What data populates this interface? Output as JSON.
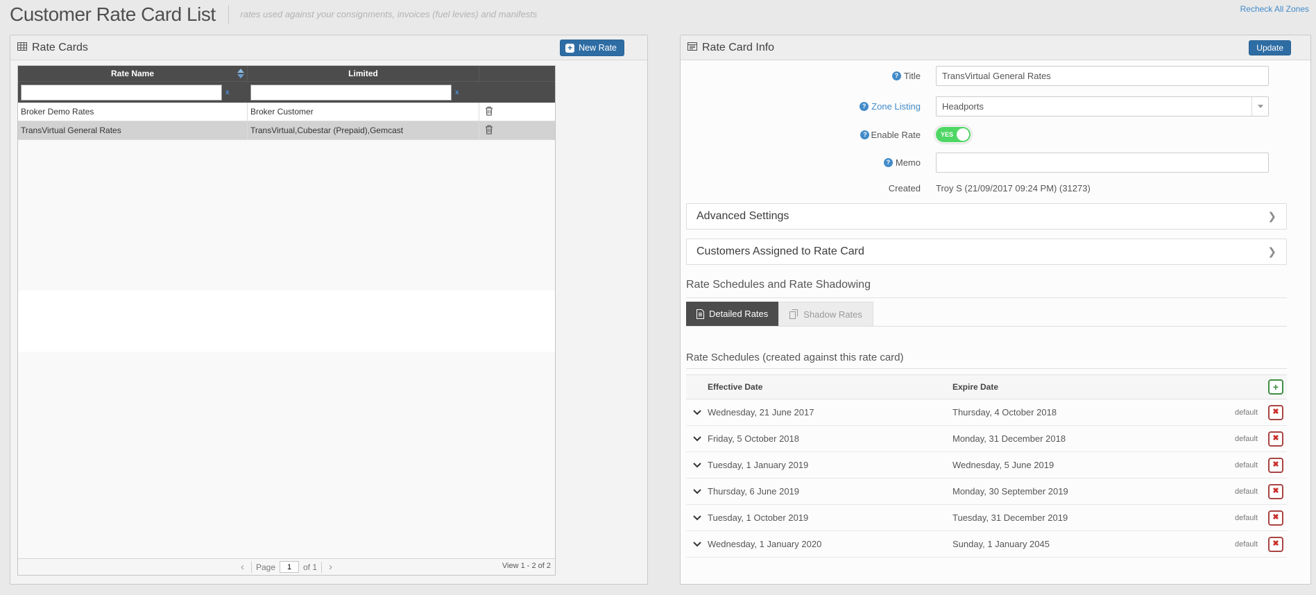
{
  "page": {
    "title": "Customer Rate Card List",
    "subtitle": "rates used against your consignments, invoices (fuel levies) and manifests",
    "recheck_link": "Recheck All Zones"
  },
  "icons": {
    "plus": "+",
    "x_mark": "✖",
    "clear_x": "x",
    "prev_arrow": "‹",
    "next_arrow": "›",
    "accordion_chevron": "❯",
    "question_mark": "?"
  },
  "rate_cards_panel": {
    "title": "Rate Cards",
    "new_rate_button": "New Rate",
    "grid": {
      "columns": [
        "Rate Name",
        "Limited"
      ],
      "rows": [
        {
          "rate_name": "Broker Demo Rates",
          "limited": "Broker Customer"
        },
        {
          "rate_name": "TransVirtual General Rates",
          "limited": "TransVirtual,Cubestar (Prepaid),Gemcast"
        }
      ],
      "pager": {
        "page_label": "Page",
        "page_value": "1",
        "of_label": "of 1",
        "view_label": "View 1 - 2 of 2"
      }
    }
  },
  "rate_card_info_panel": {
    "title": "Rate Card Info",
    "update_button": "Update",
    "fields": {
      "title_label": "Title",
      "title_value": "TransVirtual General Rates",
      "zone_listing_label": "Zone Listing",
      "zone_listing_value": "Headports",
      "enable_rate_label": "Enable Rate",
      "enable_rate_value": "YES",
      "memo_label": "Memo",
      "memo_value": "",
      "created_label": "Created",
      "created_value": "Troy S (21/09/2017 09:24 PM) (31273)"
    },
    "accordions": [
      {
        "label": "Advanced Settings"
      },
      {
        "label": "Customers Assigned to Rate Card"
      }
    ],
    "schedules": {
      "heading": "Rate Schedules and Rate Shadowing",
      "tabs": [
        {
          "label": "Detailed Rates"
        },
        {
          "label": "Shadow Rates"
        }
      ],
      "subheading": "Rate Schedules (created against this rate card)",
      "columns": [
        "Effective Date",
        "Expire Date"
      ],
      "rows": [
        {
          "effective": "Wednesday, 21 June 2017",
          "expire": "Thursday, 4 October 2018",
          "tag": "default"
        },
        {
          "effective": "Friday, 5 October 2018",
          "expire": "Monday, 31 December 2018",
          "tag": "default"
        },
        {
          "effective": "Tuesday, 1 January 2019",
          "expire": "Wednesday, 5 June 2019",
          "tag": "default"
        },
        {
          "effective": "Thursday, 6 June 2019",
          "expire": "Monday, 30 September 2019",
          "tag": "default"
        },
        {
          "effective": "Tuesday, 1 October 2019",
          "expire": "Tuesday, 31 December 2019",
          "tag": "default"
        },
        {
          "effective": "Wednesday, 1 January 2020",
          "expire": "Sunday, 1 January 2045",
          "tag": "default"
        }
      ]
    }
  },
  "colors": {
    "accent_blue": "#2e6da4",
    "link_blue": "#428bca",
    "grid_header_dark": "#4c4c4c",
    "toggle_green": "#4fd765",
    "delete_red": "#c9302c",
    "add_green": "#3f8f44",
    "selected_row": "#d2d2d2"
  }
}
